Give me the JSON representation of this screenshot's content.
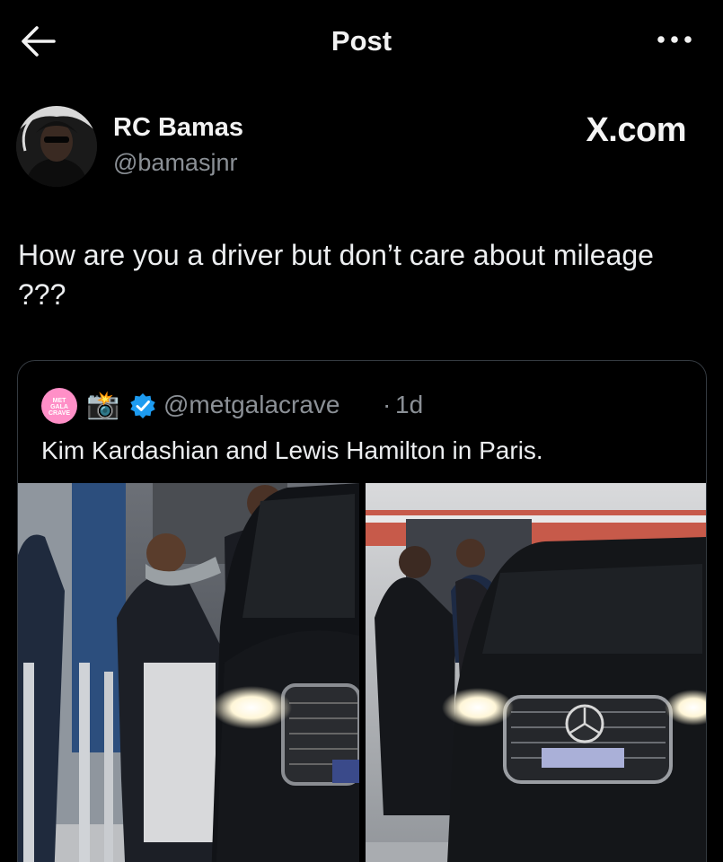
{
  "topbar": {
    "title": "Post",
    "back_icon": "arrow-left-icon",
    "more_icon": "more-horizontal-icon"
  },
  "author": {
    "name": "RC Bamas",
    "handle": "@bamasjnr",
    "watermark": "X.com"
  },
  "post": {
    "text": "How are you a driver but don’t care about mileage ???"
  },
  "quote": {
    "avatar_text": "MET GALA CRAVE",
    "emoji": "📸",
    "verified_icon": "verified-badge-icon",
    "handle": "@metgalacrave",
    "separator": "·",
    "time": "1d",
    "text": "Kim Kardashian and Lewis Hamilton in Paris."
  },
  "colors": {
    "background": "#000000",
    "text_primary": "#e7e9ea",
    "text_secondary": "#8b9096",
    "border": "#343a40",
    "verified": "#1d9bf0",
    "avatar_pink": "#ff8fc7"
  }
}
